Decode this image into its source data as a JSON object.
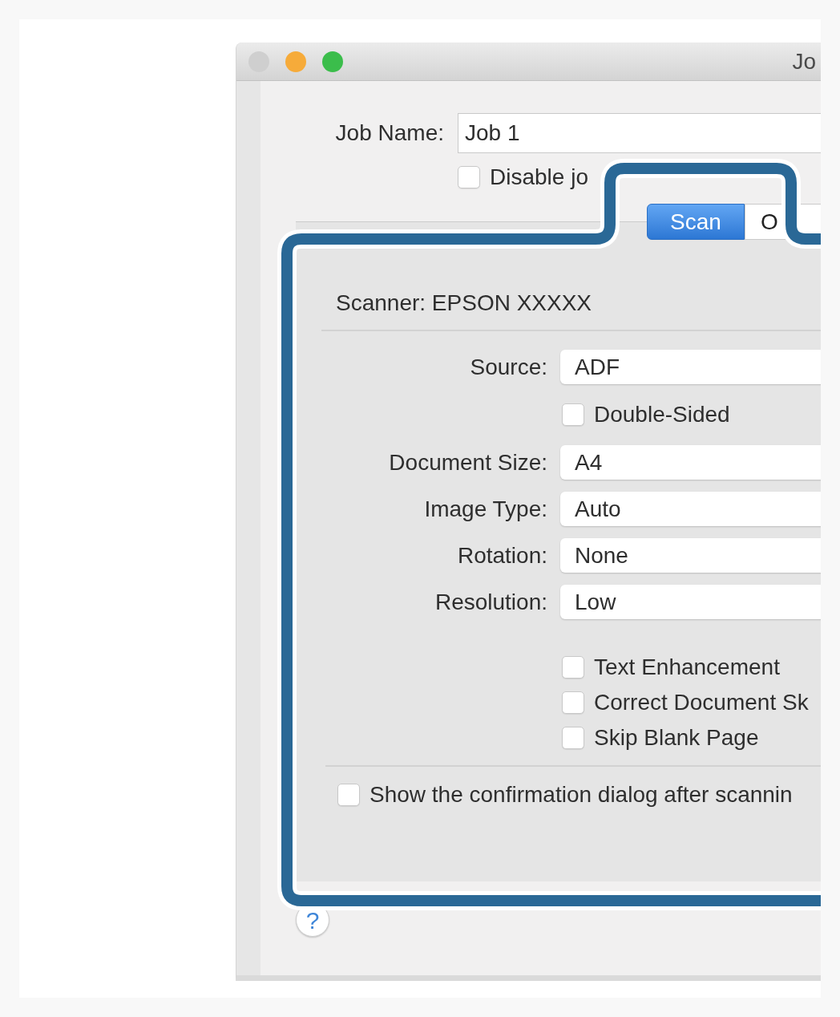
{
  "window": {
    "title": "Jo",
    "controls": [
      {
        "kind": "close",
        "disabled": true
      },
      {
        "kind": "minimize",
        "disabled": false
      },
      {
        "kind": "zoom",
        "disabled": false
      }
    ]
  },
  "job_name": {
    "label": "Job Name:",
    "value": "Job 1"
  },
  "disable_setting": {
    "label": "Disable jo",
    "checked": false
  },
  "tabs": [
    {
      "label": "Scan",
      "selected": true
    },
    {
      "label": "O",
      "selected": false
    }
  ],
  "scan_tab": {
    "scanner": "Scanner: EPSON XXXXX",
    "settings": [
      {
        "kind": "dropdown",
        "label": "Source:",
        "value": "ADF"
      },
      {
        "kind": "checkbox",
        "label": "Double-Sided",
        "checked": false
      },
      {
        "kind": "dropdown",
        "label": "Document Size:",
        "value": "A4"
      },
      {
        "kind": "dropdown",
        "label": "Image Type:",
        "value": "Auto"
      },
      {
        "kind": "dropdown",
        "label": "Rotation:",
        "value": "None"
      },
      {
        "kind": "dropdown",
        "label": "Resolution:",
        "value": "Low"
      }
    ],
    "options": [
      {
        "label": "Text Enhancement",
        "checked": false
      },
      {
        "label": "Correct Document Sk",
        "checked": false
      },
      {
        "label": "Skip Blank Page",
        "checked": false
      }
    ],
    "confirmation": {
      "label": "Show the confirmation dialog after scannin",
      "checked": false
    }
  },
  "help_button": {
    "label": "?"
  },
  "annotation": {
    "kind": "outline"
  }
}
